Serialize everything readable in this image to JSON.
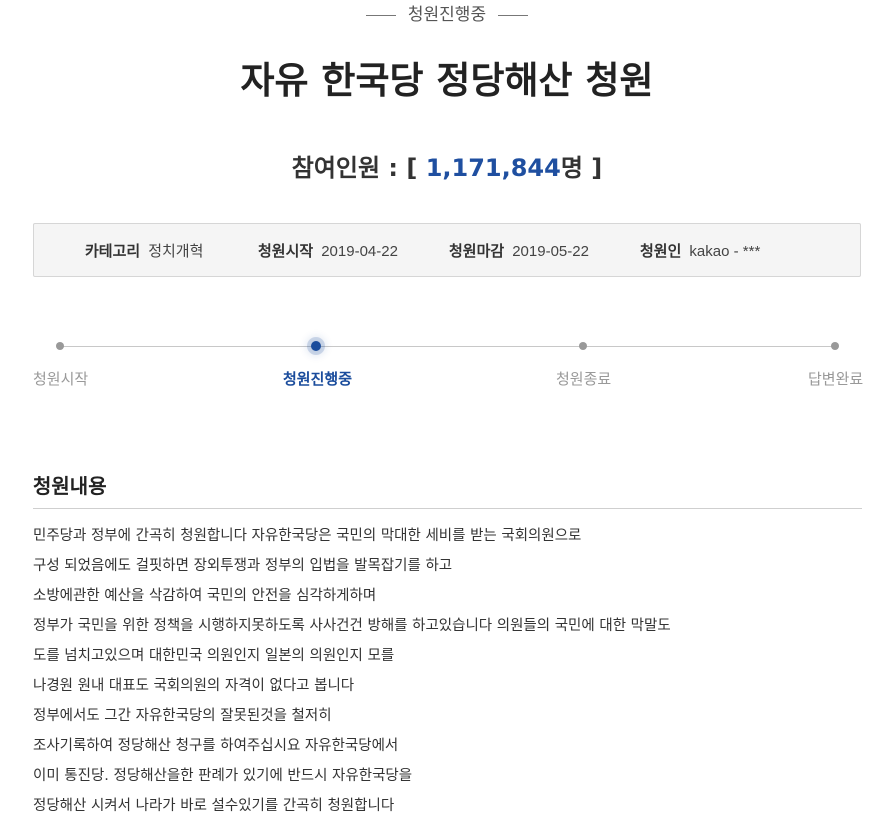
{
  "status": "청원진행중",
  "title": "자유 한국당 정당해산 청원",
  "participants": {
    "label": "참여인원 : [",
    "count": "1,171,844",
    "suffix": "명 ]"
  },
  "info": {
    "category_label": "카테고리",
    "category_value": "정치개혁",
    "start_label": "청원시작",
    "start_value": "2019-04-22",
    "end_label": "청원마감",
    "end_value": "2019-05-22",
    "author_label": "청원인",
    "author_value": "kakao - ***"
  },
  "steps": [
    {
      "label": "청원시작",
      "active": false
    },
    {
      "label": "청원진행중",
      "active": true
    },
    {
      "label": "청원종료",
      "active": false
    },
    {
      "label": "답변완료",
      "active": false
    }
  ],
  "content_title": "청원내용",
  "content_lines": [
    "민주당과 정부에 간곡히 청원합니다 자유한국당은 국민의 막대한 세비를 받는 국회의원으로",
    "구성 되었음에도 걸핏하면 장외투쟁과 정부의 입법을 발목잡기를 하고",
    "소방에관한 예산을 삭감하여 국민의 안전을 심각하게하며",
    "정부가 국민을 위한 정책을 시행하지못하도록 사사건건 방해를 하고있습니다 의원들의 국민에 대한 막말도",
    "도를 넘치고있으며 대한민국 의원인지 일본의 의원인지 모를",
    "나경원 원내 대표도 국회의원의 자격이 없다고 봅니다",
    "정부에서도 그간 자유한국당의 잘못된것을 철저히",
    "조사기록하여 정당해산 청구를 하여주십시요 자유한국당에서",
    "이미 통진당. 정당해산을한 판례가 있기에 반드시 자유한국당을",
    "정당해산 시켜서 나라가 바로 설수있기를 간곡히 청원합니다"
  ],
  "colors": {
    "accent": "#1a4c9c",
    "count": "#1f4fa0",
    "info_bg": "#f5f5f5"
  }
}
